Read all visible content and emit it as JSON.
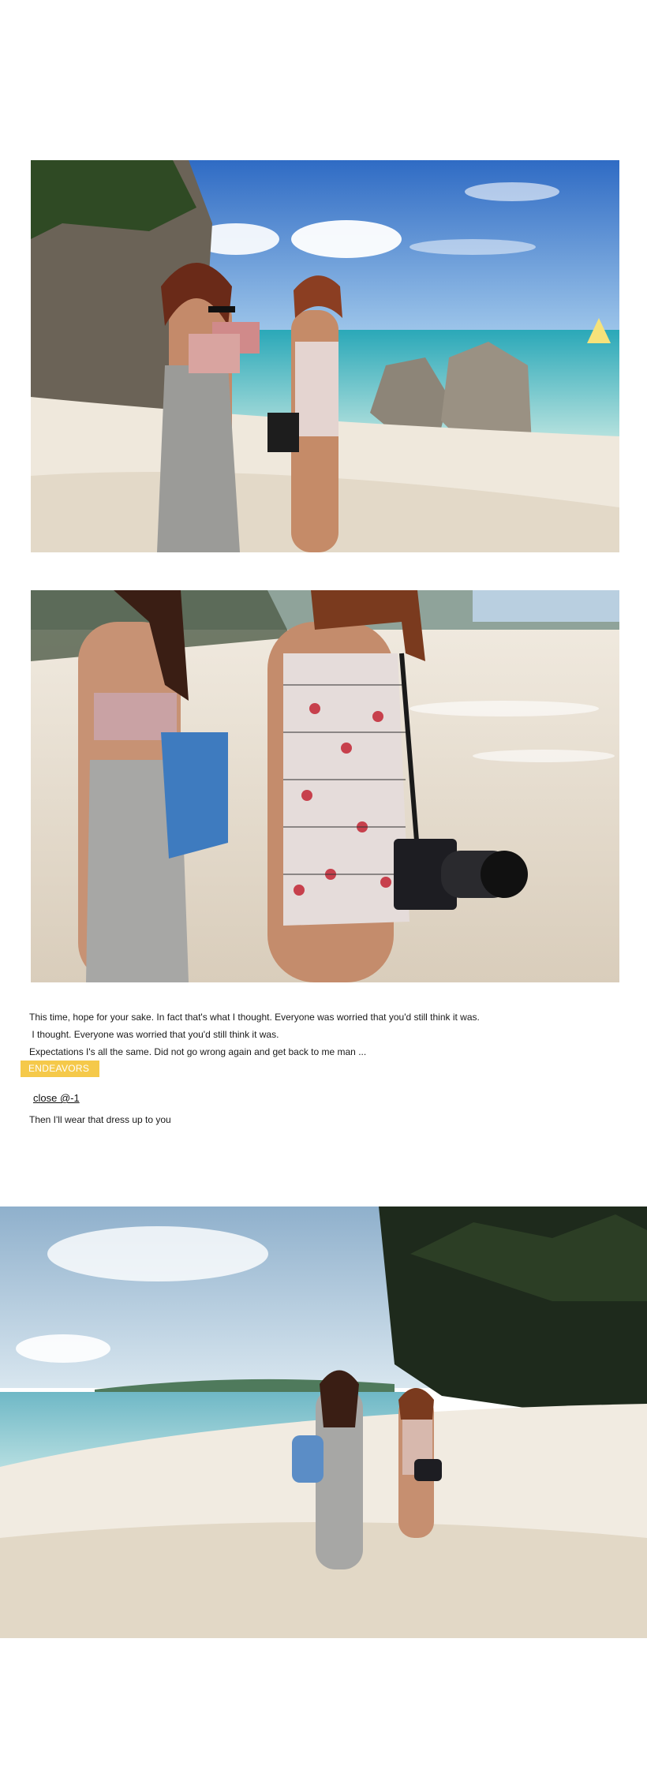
{
  "photos": [
    {
      "name": "beach-photo-1",
      "alt": "Two women walking on a beach beside rocks"
    },
    {
      "name": "beach-photo-2",
      "alt": "Two women standing on the sand, one holding a camera"
    },
    {
      "name": "beach-photo-3",
      "alt": "Two women walking along the shore under palm trees"
    }
  ],
  "text": {
    "line1": "This time, hope for your sake. In fact that's what I thought. Everyone was worried that you'd still think it was.",
    "line2": " I thought. Everyone was worried that you'd still think it was.",
    "line3": "Expectations I's all the same. Did not go wrong again and get back to me man ..."
  },
  "badge": {
    "label": "ENDEAVORS",
    "color": "#f5c94a"
  },
  "close_link": {
    "label": "close @-1"
  },
  "closing_line": "Then I'll wear that dress up to you"
}
